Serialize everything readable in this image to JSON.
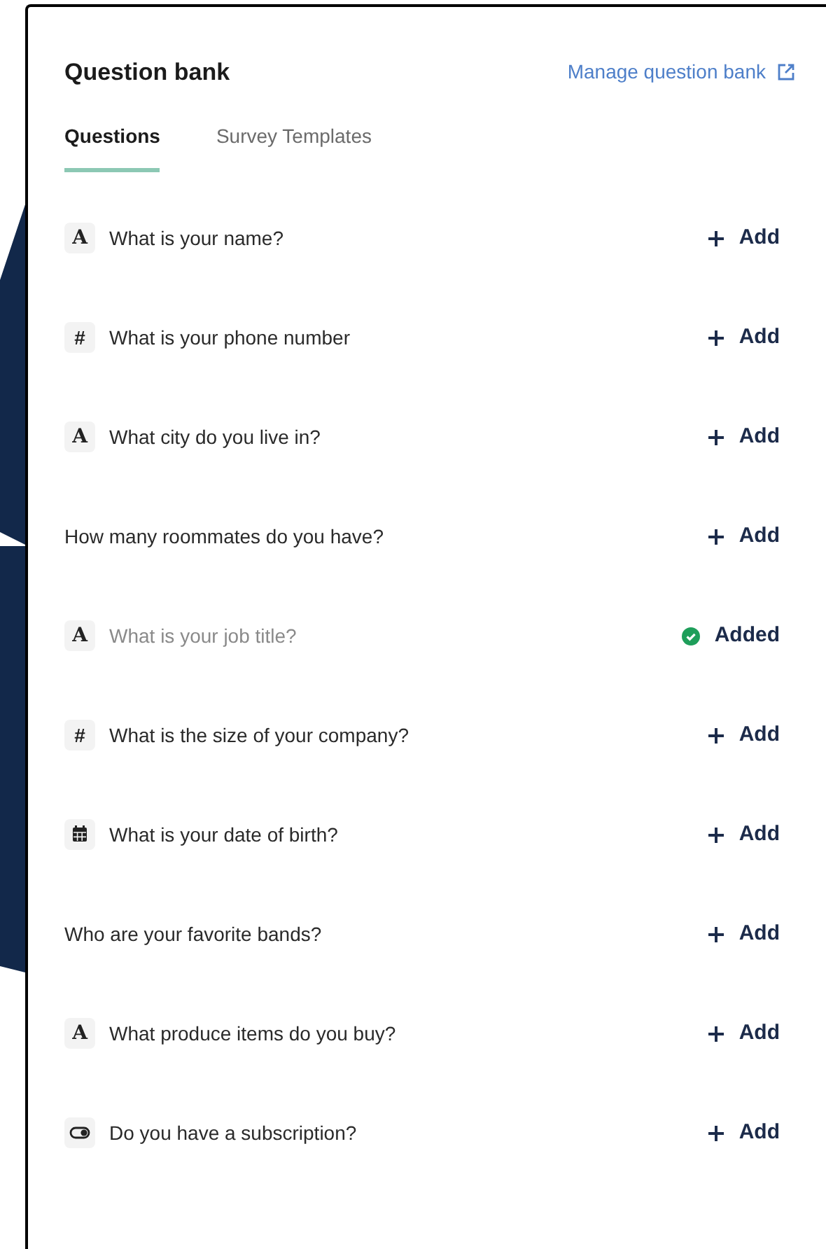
{
  "header": {
    "title": "Question bank",
    "link": "Manage question bank"
  },
  "tabs": [
    {
      "label": "Questions",
      "selected": true
    },
    {
      "label": "Survey Templates",
      "selected": false
    }
  ],
  "questions": [
    {
      "kind": "text",
      "icon": "A",
      "text": "What is your name?",
      "added": false,
      "action": "Add"
    },
    {
      "kind": "number",
      "icon": "#",
      "text": "What is your phone number",
      "added": false,
      "action": "Add"
    },
    {
      "kind": "text",
      "icon": "A",
      "text": "What city do you live in?",
      "added": false,
      "action": "Add"
    },
    {
      "kind": "plain",
      "text": "How many roommates do you have?",
      "added": false,
      "action": "Add"
    },
    {
      "kind": "text",
      "icon": "A",
      "text": "What is your job title?",
      "added": true,
      "action": "Added"
    },
    {
      "kind": "number",
      "icon": "#",
      "text": "What is the size of your company?",
      "added": false,
      "action": "Add"
    },
    {
      "kind": "date",
      "text": "What is your date of birth?",
      "added": false,
      "action": "Add"
    },
    {
      "kind": "plain",
      "text": "Who are your favorite bands?",
      "added": false,
      "action": "Add"
    },
    {
      "kind": "text",
      "icon": "A",
      "text": "What produce items do you buy?",
      "added": false,
      "action": "Add"
    },
    {
      "kind": "toggle",
      "text": "Do you have a subscription?",
      "added": false,
      "action": "Add"
    }
  ]
}
